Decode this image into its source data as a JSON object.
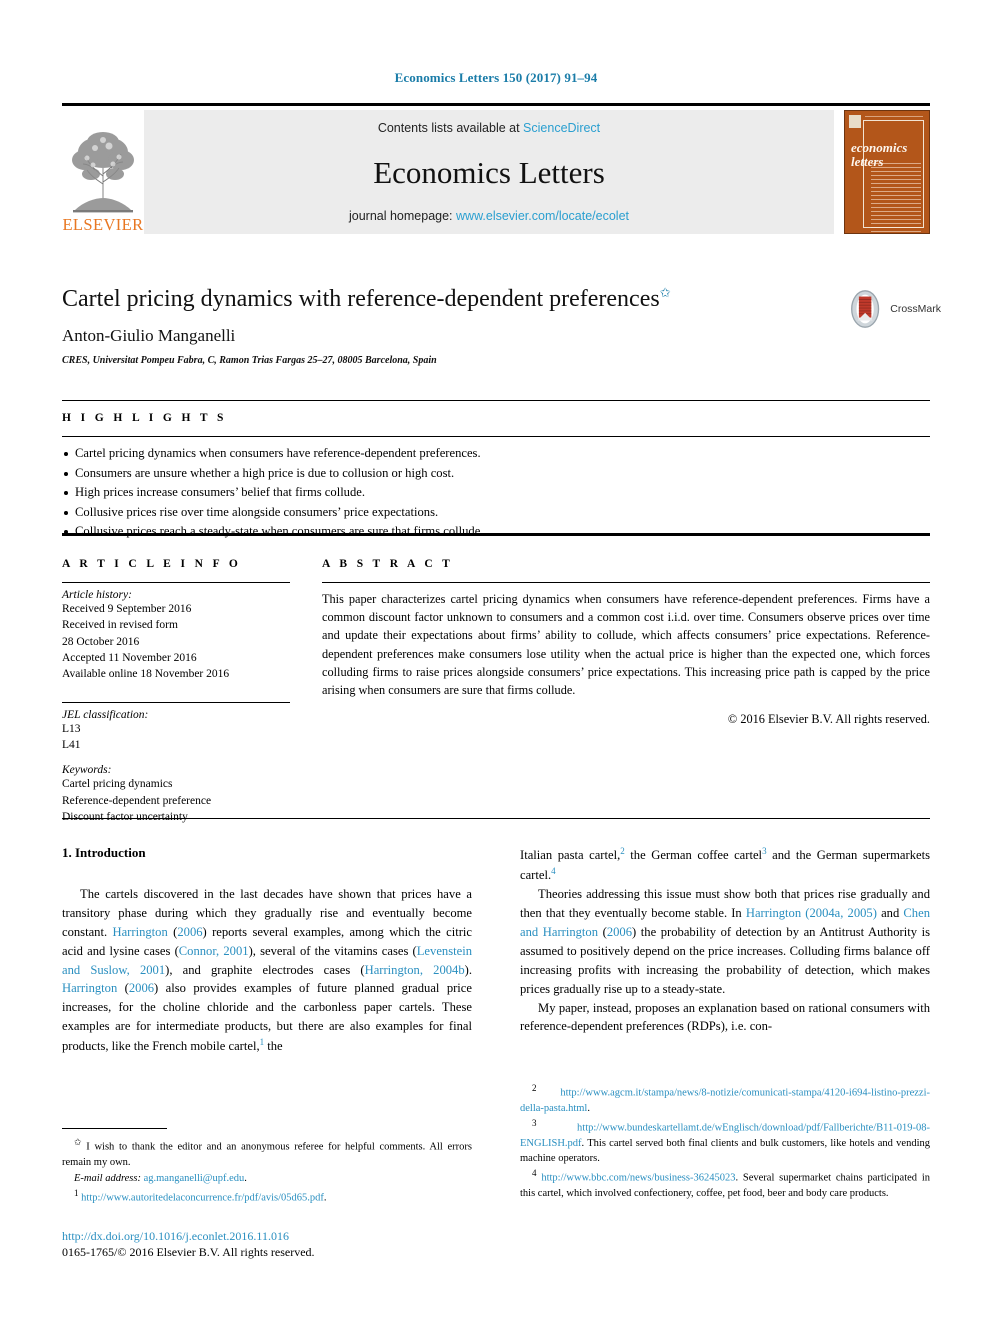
{
  "running_head": "Economics Letters 150 (2017) 91–94",
  "masthead": {
    "contents_prefix": "Contents lists available at ",
    "sciencedirect": "ScienceDirect",
    "journal_title": "Economics Letters",
    "homepage_prefix": "journal homepage: ",
    "homepage_url": "www.elsevier.com/locate/ecolet",
    "publisher_logo_text": "ELSEVIER",
    "cover_title_line1": "economics",
    "cover_title_line2": "letters"
  },
  "title_block": {
    "title": "Cartel pricing dynamics with reference-dependent preferences",
    "title_footnote_mark": "✩",
    "author": "Anton-Giulio Manganelli",
    "affiliation": "CRES, Universitat Pompeu Fabra, C, Ramon Trias Fargas 25–27, 08005 Barcelona, Spain",
    "crossmark_label": "CrossMark"
  },
  "highlights": {
    "heading": "H I G H L I G H T S",
    "items": [
      "Cartel pricing dynamics when consumers have reference-dependent preferences.",
      "Consumers are unsure whether a high price is due to collusion or high cost.",
      "High prices increase consumers’ belief that firms collude.",
      "Collusive prices rise over time alongside consumers’ price expectations.",
      "Collusive prices reach a steady-state when consumers are sure that firms collude."
    ]
  },
  "article_info": {
    "heading": "A R T I C L E    I N F O",
    "history_label": "Article history:",
    "history_lines": [
      "Received 9 September 2016",
      "Received in revised form",
      "28 October 2016",
      "Accepted 11 November 2016",
      "Available online 18 November 2016"
    ],
    "jel_label": "JEL classification:",
    "jel_codes": [
      "L13",
      "L41"
    ],
    "keywords_label": "Keywords:",
    "keywords": [
      "Cartel pricing dynamics",
      "Reference-dependent preference",
      "Discount factor uncertainty"
    ]
  },
  "abstract": {
    "heading": "A B S T R A C T",
    "text": "This paper characterizes cartel pricing dynamics when consumers have reference-dependent preferences. Firms have a common discount factor unknown to consumers and a common cost i.i.d. over time. Consumers observe prices over time and update their expectations about firms’ ability to collude, which affects consumers’ price expectations. Reference-dependent preferences make consumers lose utility when the actual price is higher than the expected one, which forces colluding firms to raise prices alongside consumers’ price expectations. This increasing price path is capped by the price arising when consumers are sure that firms collude.",
    "copyright": "© 2016 Elsevier B.V. All rights reserved."
  },
  "body": {
    "section_title": "1. Introduction",
    "left_paragraph_parts": [
      {
        "t": "The cartels discovered in the last decades have shown that prices have a transitory phase during which they gradually rise and eventually become constant. ",
        "k": "plain"
      },
      {
        "t": "Harrington",
        "k": "ref"
      },
      {
        "t": " (",
        "k": "plain"
      },
      {
        "t": "2006",
        "k": "ref"
      },
      {
        "t": ") reports several examples, among which the citric acid and lysine cases (",
        "k": "plain"
      },
      {
        "t": "Connor, 2001",
        "k": "ref"
      },
      {
        "t": "), several of the vitamins cases (",
        "k": "plain"
      },
      {
        "t": "Levenstein and Suslow, 2001",
        "k": "ref"
      },
      {
        "t": "), and graphite electrodes cases (",
        "k": "plain"
      },
      {
        "t": "Harrington, 2004b",
        "k": "ref"
      },
      {
        "t": "). ",
        "k": "plain"
      },
      {
        "t": "Harrington",
        "k": "ref"
      },
      {
        "t": " (",
        "k": "plain"
      },
      {
        "t": "2006",
        "k": "ref"
      },
      {
        "t": ") also provides examples of future planned gradual price increases, for the choline chloride and the carbonless paper cartels. These examples are for intermediate products, but there are also examples for final products, like the French mobile cartel,",
        "k": "plain"
      },
      {
        "t": "1",
        "k": "sup"
      },
      {
        "t": " the",
        "k": "plain"
      }
    ],
    "right_paragraph1_parts": [
      {
        "t": "Italian pasta cartel,",
        "k": "plain"
      },
      {
        "t": "2",
        "k": "sup"
      },
      {
        "t": " the German coffee cartel",
        "k": "plain"
      },
      {
        "t": "3",
        "k": "sup"
      },
      {
        "t": " and the German supermarkets cartel.",
        "k": "plain"
      },
      {
        "t": "4",
        "k": "sup"
      }
    ],
    "right_paragraph2_parts": [
      {
        "t": "Theories addressing this issue must show both that prices rise gradually and then that they eventually become stable. In ",
        "k": "plain"
      },
      {
        "t": "Harrington (2004a, 2005)",
        "k": "ref"
      },
      {
        "t": " and ",
        "k": "plain"
      },
      {
        "t": "Chen and Harrington",
        "k": "ref"
      },
      {
        "t": " (",
        "k": "plain"
      },
      {
        "t": "2006",
        "k": "ref"
      },
      {
        "t": ") the probability of detection by an Antitrust Authority is assumed to positively depend on the price increases. Colluding firms balance off increasing profits with increasing the probability of detection, which makes prices gradually rise up to a steady-state.",
        "k": "plain"
      }
    ],
    "right_paragraph3_parts": [
      {
        "t": "My paper, instead, proposes an explanation based on rational consumers with reference-dependent preferences (RDPs), i.e. con-",
        "k": "plain"
      }
    ]
  },
  "footnotes": {
    "left": {
      "star_mark": "✩",
      "star_text": "I wish to thank the editor and an anonymous referee for helpful comments. All errors remain my own.",
      "email_label": "E-mail address:",
      "email": "ag.manganelli@upf.edu",
      "fn1_mark": "1",
      "fn1_url": "http://www.autoritedelaconcurrence.fr/pdf/avis/05d65.pdf"
    },
    "right": [
      {
        "mark": "2",
        "url": "http://www.agcm.it/stampa/news/8-notizie/comunicati-stampa/4120-i694-listino-prezzi-della-pasta.html",
        "tail": "."
      },
      {
        "mark": "3",
        "url": "http://www.bundeskartellamt.de/wEnglisch/download/pdf/Fallberichte/B11-019-08-ENGLISH.pdf",
        "tail": ". This cartel served both final clients and bulk customers, like hotels and vending machine operators."
      },
      {
        "mark": "4",
        "url": "http://www.bbc.com/news/business-36245023",
        "tail": ". Several supermarket chains participated in this cartel, which involved confectionery, coffee, pet food, beer and body care products."
      }
    ]
  },
  "footer": {
    "doi": "http://dx.doi.org/10.1016/j.econlet.2016.11.016",
    "issn_line": "0165-1765/© 2016 Elsevier B.V. All rights reserved."
  },
  "colors": {
    "link_blue": "#2a8fc0",
    "header_blue": "#1a7ca8",
    "elsevier_orange": "#E87722",
    "masthead_grey": "#ececec",
    "cover_brown": "#b3561a"
  }
}
